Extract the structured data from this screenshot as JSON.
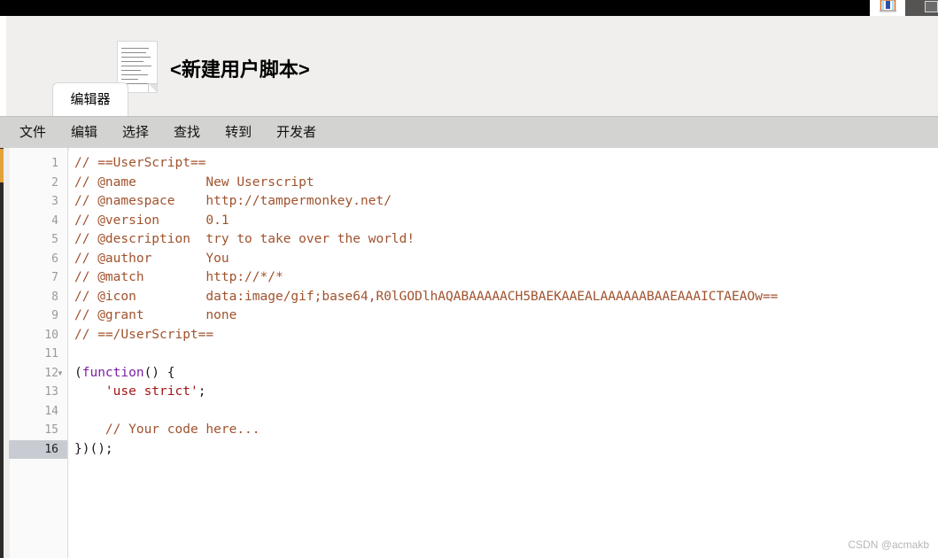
{
  "window": {
    "top_bar_icons": [
      {
        "name": "save-icon",
        "label": "save"
      },
      {
        "name": "window-control",
        "label": ""
      }
    ]
  },
  "header": {
    "title": "<新建用户脚本>",
    "thumbnail_name": "script-thumbnail-icon",
    "tabs": [
      {
        "label": "编辑器",
        "active": true
      }
    ]
  },
  "menubar": {
    "items": [
      {
        "label": "文件"
      },
      {
        "label": "编辑"
      },
      {
        "label": "选择"
      },
      {
        "label": "查找"
      },
      {
        "label": "转到"
      },
      {
        "label": "开发者"
      }
    ]
  },
  "editor": {
    "active_line": 16,
    "line_numbers": [
      "1",
      "2",
      "3",
      "4",
      "5",
      "6",
      "7",
      "8",
      "9",
      "10",
      "11",
      "12",
      "13",
      "14",
      "15",
      "16"
    ],
    "fold_lines": [
      12
    ],
    "lines": [
      {
        "n": 1,
        "segments": [
          {
            "t": "comment",
            "text": "// ==UserScript=="
          }
        ]
      },
      {
        "n": 2,
        "segments": [
          {
            "t": "comment",
            "text": "// @name         New Userscript"
          }
        ]
      },
      {
        "n": 3,
        "segments": [
          {
            "t": "comment",
            "text": "// @namespace    http://tampermonkey.net/"
          }
        ]
      },
      {
        "n": 4,
        "segments": [
          {
            "t": "comment",
            "text": "// @version      0.1"
          }
        ]
      },
      {
        "n": 5,
        "segments": [
          {
            "t": "comment",
            "text": "// @description  try to take over the world!"
          }
        ]
      },
      {
        "n": 6,
        "segments": [
          {
            "t": "comment",
            "text": "// @author       You"
          }
        ]
      },
      {
        "n": 7,
        "segments": [
          {
            "t": "comment",
            "text": "// @match        http://*/*"
          }
        ]
      },
      {
        "n": 8,
        "segments": [
          {
            "t": "comment",
            "text": "// @icon         data:image/gif;base64,R0lGODlhAQABAAAAACH5BAEKAAEALAAAAAABAAEAAAICTAEAOw=="
          }
        ]
      },
      {
        "n": 9,
        "segments": [
          {
            "t": "comment",
            "text": "// @grant        none"
          }
        ]
      },
      {
        "n": 10,
        "segments": [
          {
            "t": "comment",
            "text": "// ==/UserScript=="
          }
        ]
      },
      {
        "n": 11,
        "segments": [
          {
            "t": "plain",
            "text": ""
          }
        ]
      },
      {
        "n": 12,
        "segments": [
          {
            "t": "punct",
            "text": "("
          },
          {
            "t": "keyword",
            "text": "function"
          },
          {
            "t": "punct",
            "text": "() {"
          }
        ]
      },
      {
        "n": 13,
        "segments": [
          {
            "t": "plain",
            "text": "    "
          },
          {
            "t": "string",
            "text": "'use strict'"
          },
          {
            "t": "punct",
            "text": ";"
          }
        ]
      },
      {
        "n": 14,
        "segments": [
          {
            "t": "plain",
            "text": ""
          }
        ]
      },
      {
        "n": 15,
        "segments": [
          {
            "t": "plain",
            "text": "    "
          },
          {
            "t": "comment",
            "text": "// Your code here..."
          }
        ]
      },
      {
        "n": 16,
        "segments": [
          {
            "t": "punct",
            "text": "})();"
          }
        ]
      }
    ]
  },
  "watermark": {
    "text": "CSDN @acmakb"
  },
  "colors": {
    "comment": "#a0522d",
    "keyword": "#7b1fa2",
    "string": "#a31515",
    "accent_amber": "#e3a13a",
    "menubar_bg": "#d3d3d1",
    "header_bg": "#f0efed",
    "active_line_bg": "#c8ccd2"
  }
}
